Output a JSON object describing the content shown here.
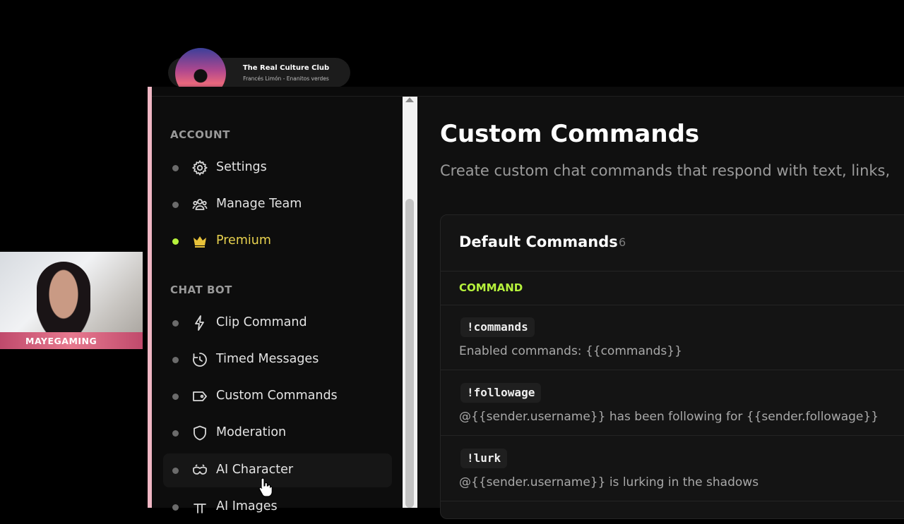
{
  "now_playing": {
    "title": "The Real Culture Club",
    "artist": "Francés Limón - Enanitos verdes"
  },
  "webcam": {
    "name": "MAYEGAMING"
  },
  "sidebar": {
    "sections": [
      {
        "label": "ACCOUNT"
      },
      {
        "label": "CHAT BOT"
      }
    ],
    "items": [
      {
        "label": "Settings",
        "icon": "gear-icon"
      },
      {
        "label": "Manage Team",
        "icon": "team-icon"
      },
      {
        "label": "Premium",
        "icon": "crown-icon",
        "active": true
      },
      {
        "label": "Clip Command",
        "icon": "lightning-icon"
      },
      {
        "label": "Timed Messages",
        "icon": "timer-icon"
      },
      {
        "label": "Custom Commands",
        "icon": "tag-icon"
      },
      {
        "label": "Moderation",
        "icon": "shield-icon"
      },
      {
        "label": "AI Character",
        "icon": "ai-mask-icon"
      },
      {
        "label": "AI Images",
        "icon": "pi-icon"
      }
    ]
  },
  "main": {
    "title": "Custom Commands",
    "subtitle": "Create custom chat commands that respond with text, links,",
    "card": {
      "title": "Default Commands",
      "count": "6",
      "column_header": "COMMAND",
      "commands": [
        {
          "name": "!commands",
          "response": "Enabled commands: {{commands}}"
        },
        {
          "name": "!followage",
          "response": "@{{sender.username}} has been following for {{sender.followage}}"
        },
        {
          "name": "!lurk",
          "response": "@{{sender.username}} is lurking in the shadows"
        }
      ]
    }
  },
  "colors": {
    "accent": "#b6f23c",
    "premium": "#e8d24f",
    "background": "#0f0f0f"
  }
}
